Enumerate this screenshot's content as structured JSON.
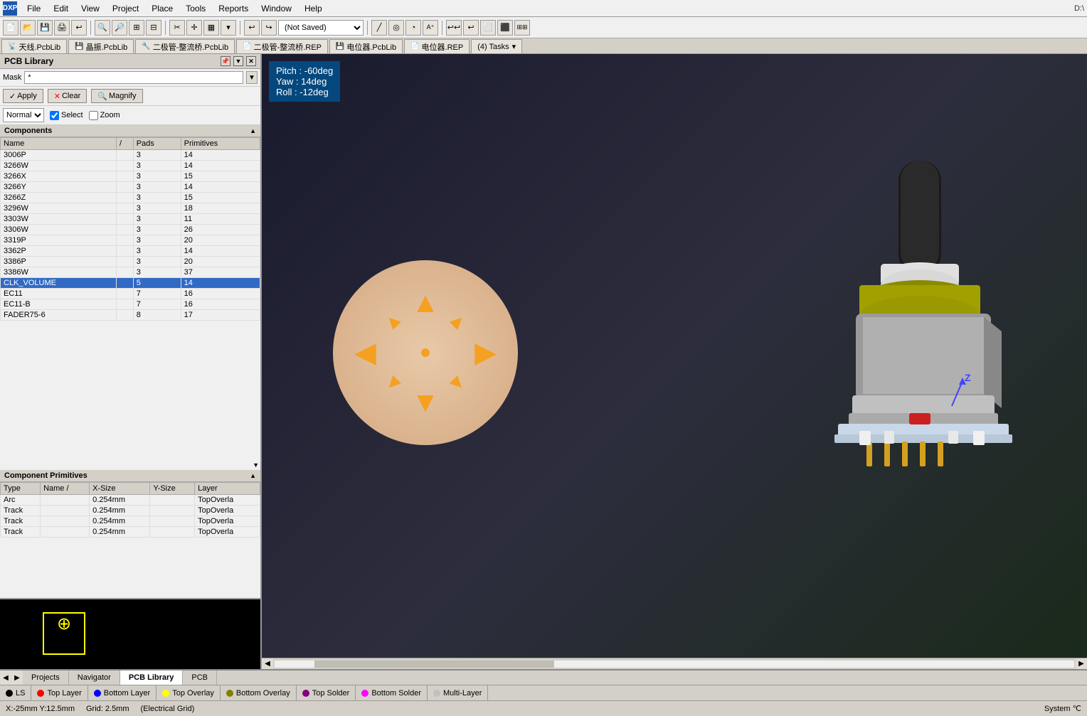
{
  "menubar": {
    "logo": "DXP",
    "items": [
      "File",
      "Edit",
      "View",
      "Project",
      "Place",
      "Tools",
      "Reports",
      "Window",
      "Help"
    ],
    "path": "D:\\"
  },
  "toolbar": {
    "dropdown_value": "(Not Saved)"
  },
  "tabs": [
    {
      "label": "天线.PcbLib",
      "icon": "📡",
      "active": false
    },
    {
      "label": "晶振.PcbLib",
      "icon": "💾",
      "active": false
    },
    {
      "label": "二极管-整流桥.PcbLib",
      "icon": "🔧",
      "active": false
    },
    {
      "label": "二极管-整流桥.REP",
      "icon": "📄",
      "active": false
    },
    {
      "label": "电位器.PcbLib",
      "icon": "💾",
      "active": false
    },
    {
      "label": "电位器.REP",
      "icon": "📄",
      "active": false
    },
    {
      "label": "(4) Tasks",
      "icon": "📋",
      "active": false
    }
  ],
  "left_panel": {
    "title": "PCB Library",
    "mask_label": "Mask",
    "mask_value": "*",
    "apply_label": "Apply",
    "clear_label": "Clear",
    "magnify_label": "Magnify",
    "normal_label": "Normal",
    "select_label": "Select",
    "zoom_label": "Zoom",
    "components_label": "Components",
    "components_cols": [
      "Name",
      "/",
      "Pads",
      "Primitives"
    ],
    "components": [
      {
        "name": "3006P",
        "sep": "",
        "pads": "3",
        "primitives": "14"
      },
      {
        "name": "3266W",
        "sep": "",
        "pads": "3",
        "primitives": "14"
      },
      {
        "name": "3266X",
        "sep": "",
        "pads": "3",
        "primitives": "15"
      },
      {
        "name": "3266Y",
        "sep": "",
        "pads": "3",
        "primitives": "14"
      },
      {
        "name": "3266Z",
        "sep": "",
        "pads": "3",
        "primitives": "15"
      },
      {
        "name": "3296W",
        "sep": "",
        "pads": "3",
        "primitives": "18"
      },
      {
        "name": "3303W",
        "sep": "",
        "pads": "3",
        "primitives": "11"
      },
      {
        "name": "3306W",
        "sep": "",
        "pads": "3",
        "primitives": "26"
      },
      {
        "name": "3319P",
        "sep": "",
        "pads": "3",
        "primitives": "20"
      },
      {
        "name": "3362P",
        "sep": "",
        "pads": "3",
        "primitives": "14"
      },
      {
        "name": "3386P",
        "sep": "",
        "pads": "3",
        "primitives": "20"
      },
      {
        "name": "3386W",
        "sep": "",
        "pads": "3",
        "primitives": "37"
      },
      {
        "name": "CLK_VOLUME",
        "sep": "",
        "pads": "5",
        "primitives": "14",
        "selected": true
      },
      {
        "name": "EC11",
        "sep": "",
        "pads": "7",
        "primitives": "16"
      },
      {
        "name": "EC11-B",
        "sep": "",
        "pads": "7",
        "primitives": "16"
      },
      {
        "name": "FADER75-6",
        "sep": "",
        "pads": "8",
        "primitives": "17"
      }
    ],
    "primitives_label": "Component Primitives",
    "primitives_cols": [
      "Type",
      "Name /",
      "X-Size",
      "Y-Size",
      "Layer"
    ],
    "primitives": [
      {
        "type": "Arc",
        "name": "",
        "xsize": "0.254mm",
        "ysize": "",
        "layer": "TopOverla"
      },
      {
        "type": "Track",
        "name": "",
        "xsize": "0.254mm",
        "ysize": "",
        "layer": "TopOverla"
      },
      {
        "type": "Track",
        "name": "",
        "xsize": "0.254mm",
        "ysize": "",
        "layer": "TopOverla"
      },
      {
        "type": "Track",
        "name": "",
        "xsize": "0.254mm",
        "ysize": "",
        "layer": "TopOverla"
      }
    ]
  },
  "canvas": {
    "info": {
      "pitch": "Pitch : -60deg",
      "yaw": "Yaw : 14deg",
      "roll": "Roll : -12deg"
    }
  },
  "layer_tabs": [
    {
      "label": "LS",
      "color": "#000000"
    },
    {
      "label": "Top Layer",
      "color": "#ff0000"
    },
    {
      "label": "Bottom Layer",
      "color": "#0000ff"
    },
    {
      "label": "Top Overlay",
      "color": "#ffff00"
    },
    {
      "label": "Bottom Overlay",
      "color": "#808000"
    },
    {
      "label": "Top Solder",
      "color": "#800080"
    },
    {
      "label": "Bottom Solder",
      "color": "#ff00ff"
    },
    {
      "label": "Multi-Layer",
      "color": "#c0c0c0"
    }
  ],
  "bottom_tabs": [
    {
      "label": "Projects"
    },
    {
      "label": "Navigator"
    },
    {
      "label": "PCB Library",
      "active": true
    },
    {
      "label": "PCB"
    }
  ],
  "statusbar": {
    "coords": "X:-25mm Y:12.5mm",
    "grid": "Grid: 2.5mm",
    "mode": "(Electrical Grid)",
    "right": "System  ℃"
  }
}
